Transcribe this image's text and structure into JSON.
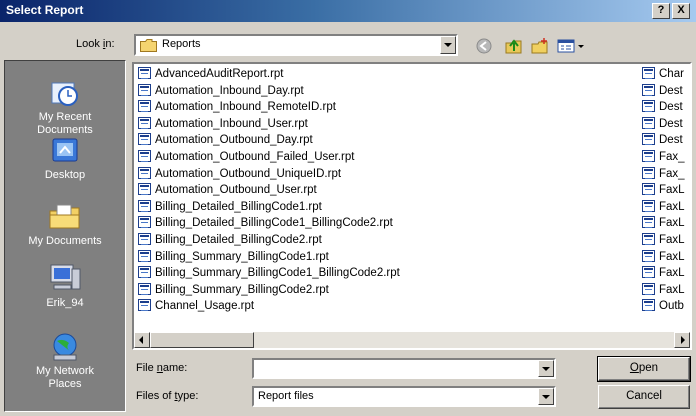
{
  "window": {
    "title": "Select Report",
    "help_label": "?",
    "close_label": "X",
    "titlebar_colors": [
      "#0a246a",
      "#a6caf0"
    ]
  },
  "lookin": {
    "label": "Look in:",
    "label_underline": "i",
    "value": "Reports"
  },
  "toolbar": [
    "back-icon",
    "up-folder-icon",
    "new-folder-icon",
    "views-menu-icon"
  ],
  "places": [
    {
      "label": "My Recent\nDocuments",
      "icon": "recent-documents-icon"
    },
    {
      "label": "Desktop",
      "icon": "desktop-icon"
    },
    {
      "label": "My Documents",
      "icon": "my-documents-icon"
    },
    {
      "label": "Erik_94",
      "icon": "my-computer-icon"
    },
    {
      "label": "My Network\nPlaces",
      "icon": "network-places-icon"
    }
  ],
  "files": [
    "AdvancedAuditReport.rpt",
    "Automation_Inbound_Day.rpt",
    "Automation_Inbound_RemoteID.rpt",
    "Automation_Inbound_User.rpt",
    "Automation_Outbound_Day.rpt",
    "Automation_Outbound_Failed_User.rpt",
    "Automation_Outbound_UniqueID.rpt",
    "Automation_Outbound_User.rpt",
    "Billing_Detailed_BillingCode1.rpt",
    "Billing_Detailed_BillingCode1_BillingCode2.rpt",
    "Billing_Detailed_BillingCode2.rpt",
    "Billing_Summary_BillingCode1.rpt",
    "Billing_Summary_BillingCode1_BillingCode2.rpt",
    "Billing_Summary_BillingCode2.rpt",
    "Channel_Usage.rpt"
  ],
  "files_col2": [
    "Char",
    "Dest",
    "Dest",
    "Dest",
    "Dest",
    "Fax_",
    "Fax_",
    "FaxL",
    "FaxL",
    "FaxL",
    "FaxL",
    "FaxL",
    "FaxL",
    "FaxL",
    "Outb"
  ],
  "filename": {
    "label": "File name:",
    "value": ""
  },
  "filetype": {
    "label": "Files of type:",
    "value": "Report files"
  },
  "buttons": {
    "open": "Open",
    "cancel": "Cancel"
  }
}
